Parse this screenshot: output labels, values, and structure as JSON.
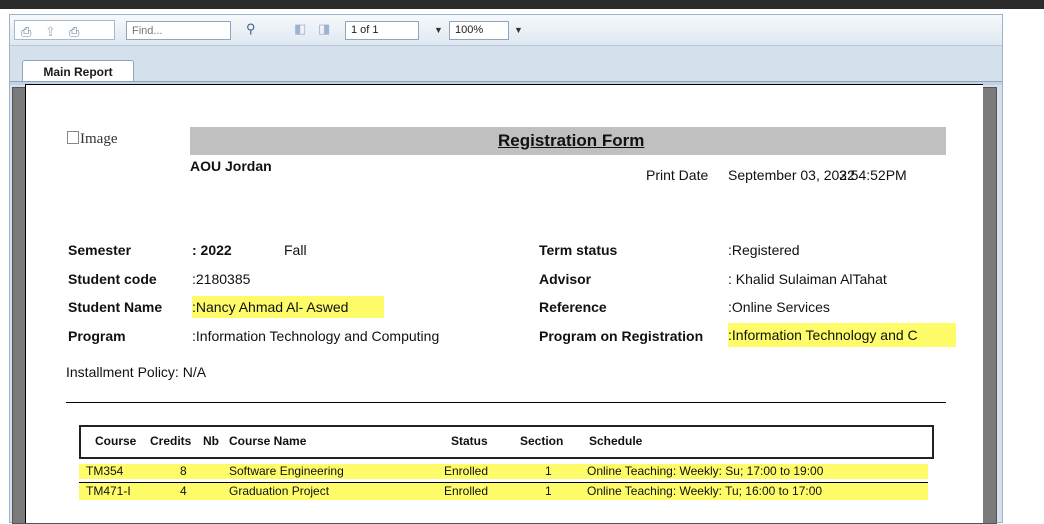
{
  "toolbar": {
    "find_placeholder": "Find...",
    "page_value": "1 of 1",
    "zoom_value": "100%"
  },
  "tabs": {
    "main": "Main Report"
  },
  "report": {
    "logo_alt": "Image",
    "title": "Registration Form",
    "org": "AOU Jordan",
    "print_date_label": "Print Date",
    "print_date_value": "September 03, 2022",
    "print_time_value": "3:54:52PM",
    "left": {
      "semester_label": "Semester",
      "semester_value": ": 2022",
      "semester_term": "Fall",
      "code_label": "Student code",
      "code_value": ":2180385",
      "name_label": "Student Name",
      "name_value": ":Nancy Ahmad Al- Aswed",
      "program_label": "Program",
      "program_value": ":Information Technology and Computing"
    },
    "right": {
      "term_label": "Term status",
      "term_value": ":Registered",
      "advisor_label": "Advisor",
      "advisor_value": ": Khalid Sulaiman AlTahat",
      "ref_label": "Reference",
      "ref_value": ":Online Services",
      "por_label": "Program on Registration",
      "por_value": ":Information Technology and C"
    },
    "installment": "Installment Policy: N/A",
    "table": {
      "headers": [
        "Course",
        "Credits",
        "Nb",
        "Course Name",
        "Status",
        "Section",
        "Schedule"
      ],
      "rows": [
        {
          "course": "TM354",
          "credits": "8",
          "name": "Software Engineering",
          "status": "Enrolled",
          "section": "1",
          "schedule": "Online Teaching: Weekly: Su; 17:00 to 19:00"
        },
        {
          "course": "TM471-I",
          "credits": "4",
          "name": "Graduation Project",
          "status": "Enrolled",
          "section": "1",
          "schedule": "Online Teaching: Weekly: Tu; 16:00 to 17:00"
        }
      ]
    }
  }
}
